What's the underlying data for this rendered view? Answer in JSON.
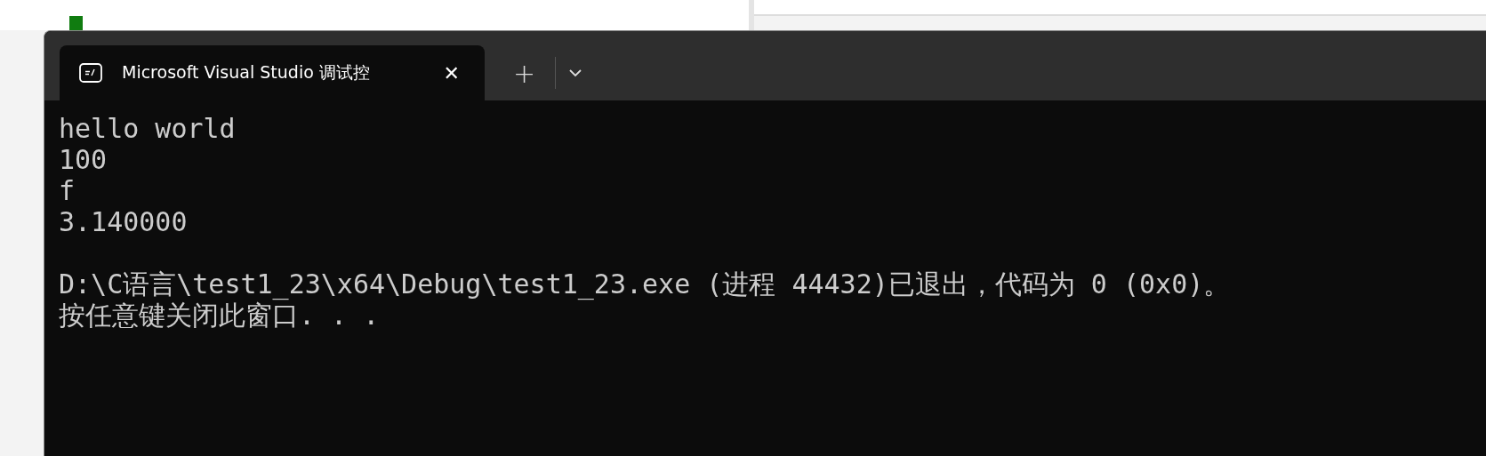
{
  "tabs": [
    {
      "title": "Microsoft Visual Studio 调试控",
      "selected": true,
      "close": "✕"
    }
  ],
  "new_tab": "+",
  "console": {
    "output": [
      "hello world",
      "100",
      "f",
      "3.140000"
    ],
    "messages": [
      "D:\\C语言\\test1_23\\x64\\Debug\\test1_23.exe (进程 44432)已退出，代码为 0 (0x0)。",
      "按任意键关闭此窗口. . ."
    ]
  }
}
